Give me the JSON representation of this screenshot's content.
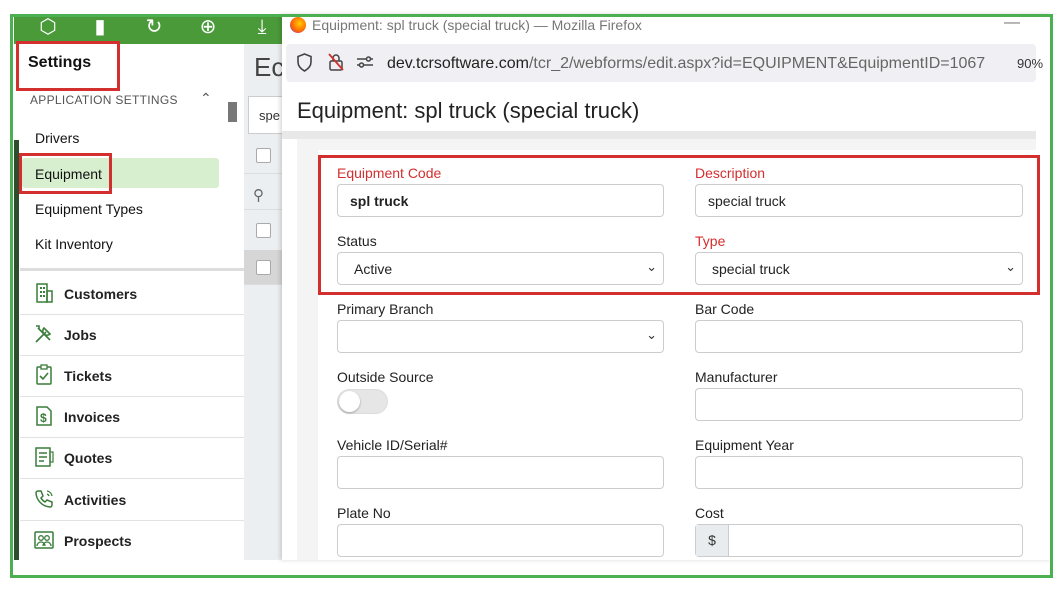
{
  "app": {
    "settings_title": "Settings",
    "section_label": "APPLICATION SETTINGS",
    "settings_items": [
      "Drivers",
      "Equipment",
      "Equipment Types",
      "Kit Inventory"
    ],
    "nav_items": [
      {
        "label": "Customers",
        "icon": "building-icon"
      },
      {
        "label": "Jobs",
        "icon": "tools-icon"
      },
      {
        "label": "Tickets",
        "icon": "clipboard-check-icon"
      },
      {
        "label": "Invoices",
        "icon": "dollar-document-icon"
      },
      {
        "label": "Quotes",
        "icon": "quote-document-icon"
      },
      {
        "label": "Activities",
        "icon": "phone-icon"
      },
      {
        "label": "Prospects",
        "icon": "people-icon"
      }
    ],
    "background_heading": "Ec",
    "background_search_value": "spe"
  },
  "browser": {
    "window_title": "Equipment: spl truck (special truck) — Mozilla Firefox",
    "url_domain": "dev.tcrsoftware.com",
    "url_path": "/tcr_2/webforms/edit.aspx?id=EQUIPMENT&EquipmentID=1067",
    "zoom": "90%"
  },
  "form": {
    "page_title": "Equipment: spl truck (special truck)",
    "fields": {
      "equipment_code": {
        "label": "Equipment Code",
        "value": "spl truck"
      },
      "description": {
        "label": "Description",
        "value": "special truck"
      },
      "status": {
        "label": "Status",
        "value": "Active"
      },
      "type": {
        "label": "Type",
        "value": "special truck"
      },
      "primary_branch": {
        "label": "Primary Branch",
        "value": ""
      },
      "bar_code": {
        "label": "Bar Code",
        "value": ""
      },
      "outside_source": {
        "label": "Outside Source",
        "value": false
      },
      "manufacturer": {
        "label": "Manufacturer",
        "value": ""
      },
      "vehicle_id": {
        "label": "Vehicle ID/Serial#",
        "value": ""
      },
      "equipment_year": {
        "label": "Equipment Year",
        "value": ""
      },
      "plate_no": {
        "label": "Plate No",
        "value": ""
      },
      "cost": {
        "label": "Cost",
        "prefix": "$",
        "value": ""
      }
    }
  },
  "colors": {
    "accent_green": "#4a9a3a",
    "highlight_red": "#d32f2f",
    "required_label": "#d32f2f"
  }
}
